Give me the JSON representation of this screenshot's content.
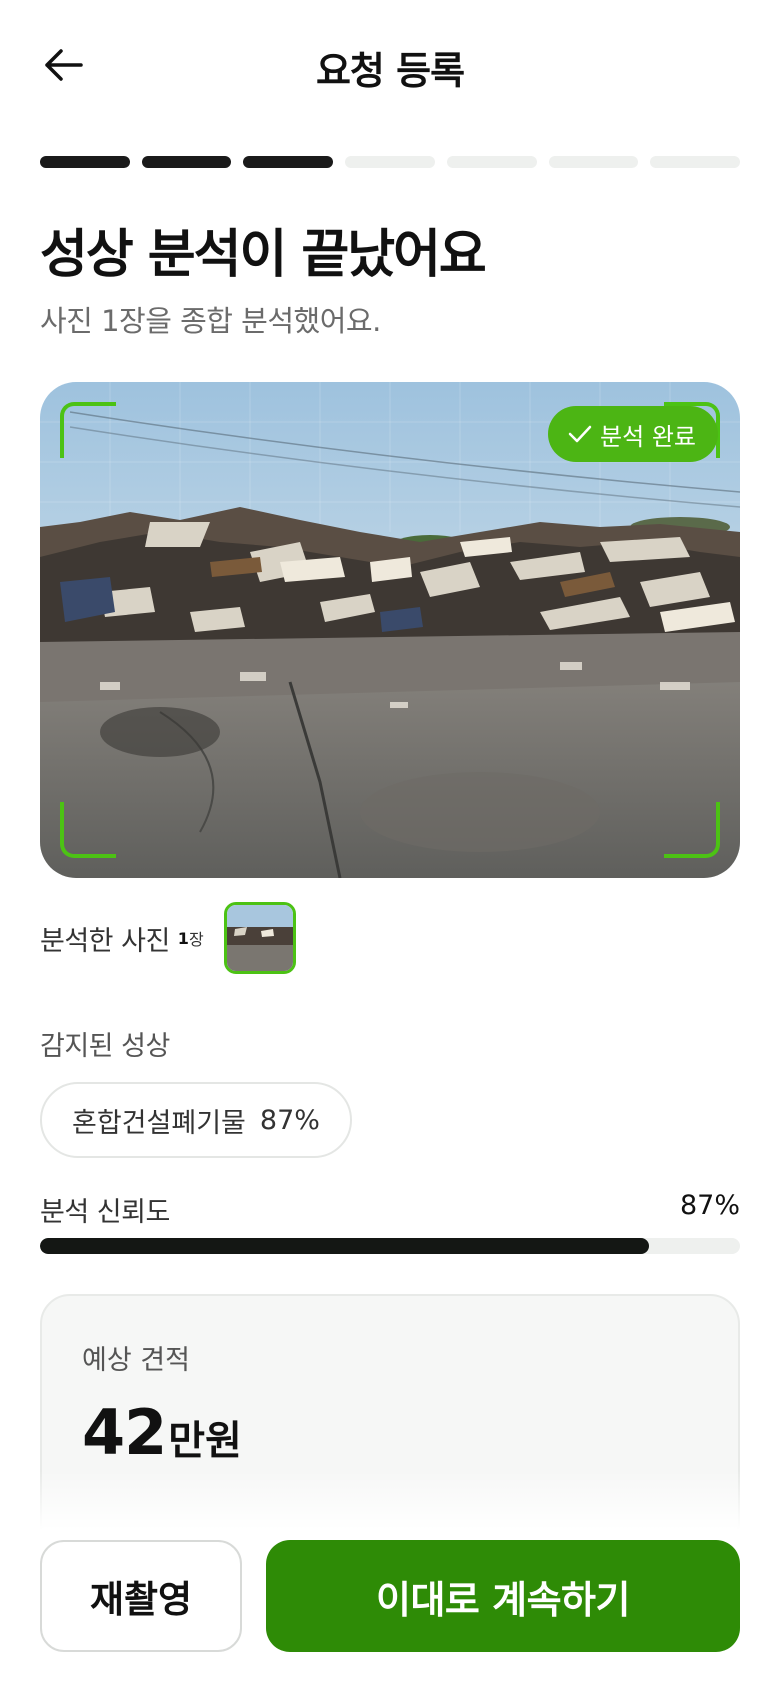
{
  "header": {
    "title": "요청 등록",
    "back_icon": "arrow-left-icon"
  },
  "progress": {
    "current_step": 3,
    "total_steps": 7
  },
  "result": {
    "title": "성상 분석이 끝났어요",
    "subtitle": "사진 1장을 종합 분석했어요."
  },
  "photo": {
    "badge_label": "분석 완료",
    "badge_icon": "check-icon",
    "accent_color": "#4cc214"
  },
  "thumbs": {
    "label": "분석한 사진",
    "count": "1",
    "unit": "장"
  },
  "detected": {
    "label": "감지된 성상",
    "chips": [
      {
        "name": "혼합건설폐기물",
        "pct": "87%"
      }
    ]
  },
  "confidence": {
    "label": "분석 신뢰도",
    "value": "87%",
    "fraction": 0.87
  },
  "estimate": {
    "label": "예상 견적",
    "amount": "42",
    "unit": "만원"
  },
  "actions": {
    "retake_label": "재촬영",
    "continue_label": "이대로 계속하기",
    "continue_color": "#2e8b06"
  }
}
